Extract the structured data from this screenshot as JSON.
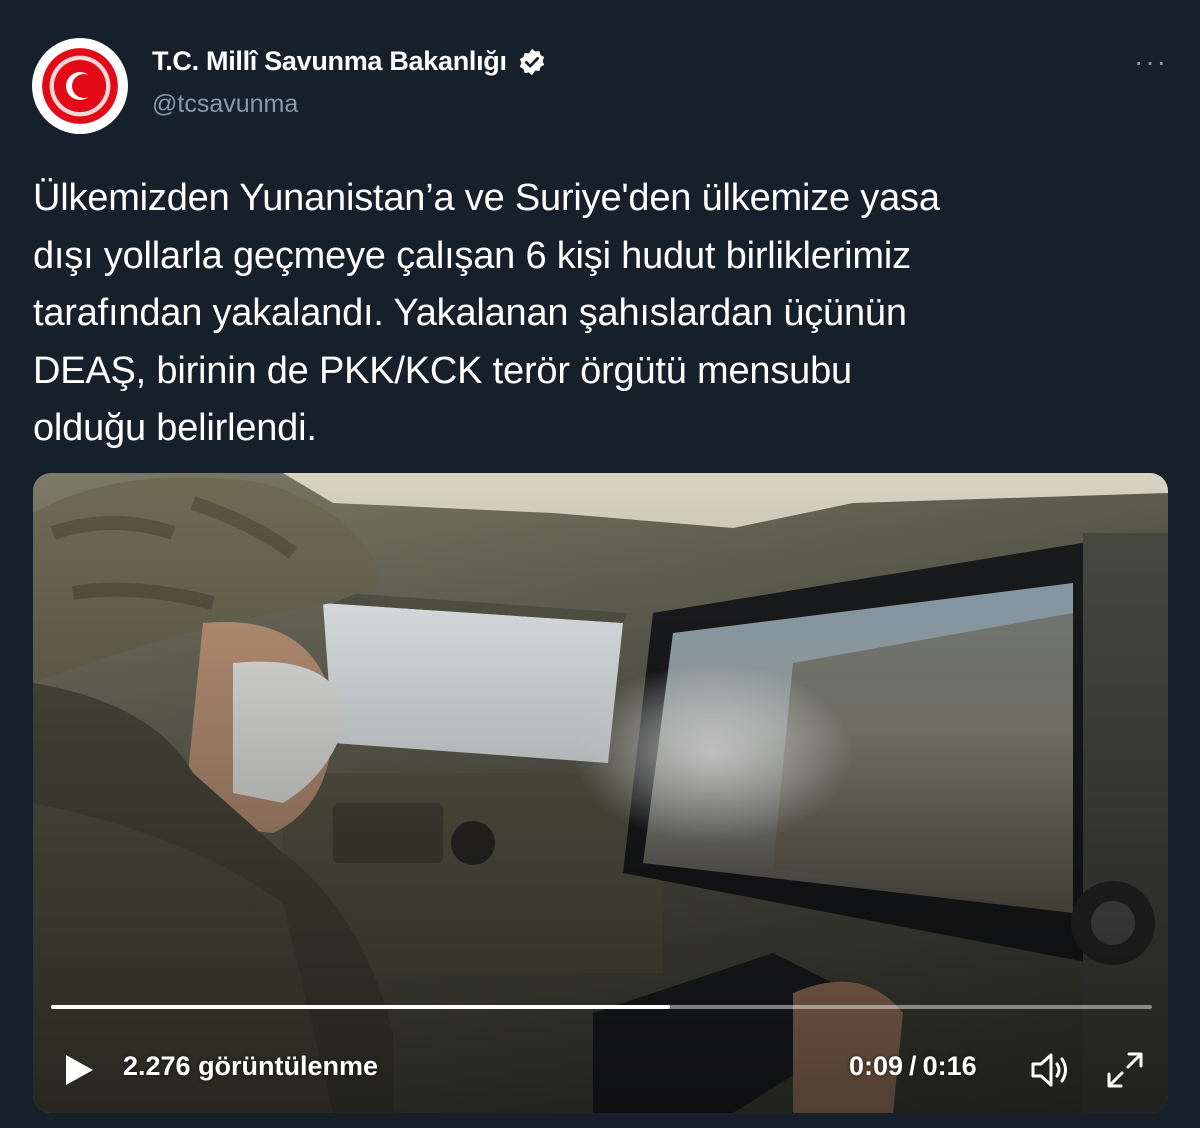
{
  "account": {
    "display_name": "T.C. Millî Savunma Bakanlığı",
    "handle": "@tcsavunma",
    "verified": true
  },
  "menu": {
    "more_label": "···"
  },
  "tweet": {
    "text": "Ülkemizden Yunanistan’a ve Suriye'den ülkemize yasa\ndışı yollarla geçmeye çalışan 6 kişi hudut birliklerimiz\ntarafından yakalandı. Yakalanan şahıslardan üçünün\nDEAŞ, birinin de PKK/KCK terör örgütü mensubu\nolduğu belirlendi."
  },
  "video": {
    "views": "2.276 görüntülenme",
    "current_time": "0:09",
    "separator": "/",
    "duration": "0:16",
    "progress_fraction": 0.5625
  },
  "colors": {
    "background": "#15202b",
    "text": "#ffffff",
    "secondary_text": "#8899a6",
    "verified_badge": "#ffffff"
  }
}
